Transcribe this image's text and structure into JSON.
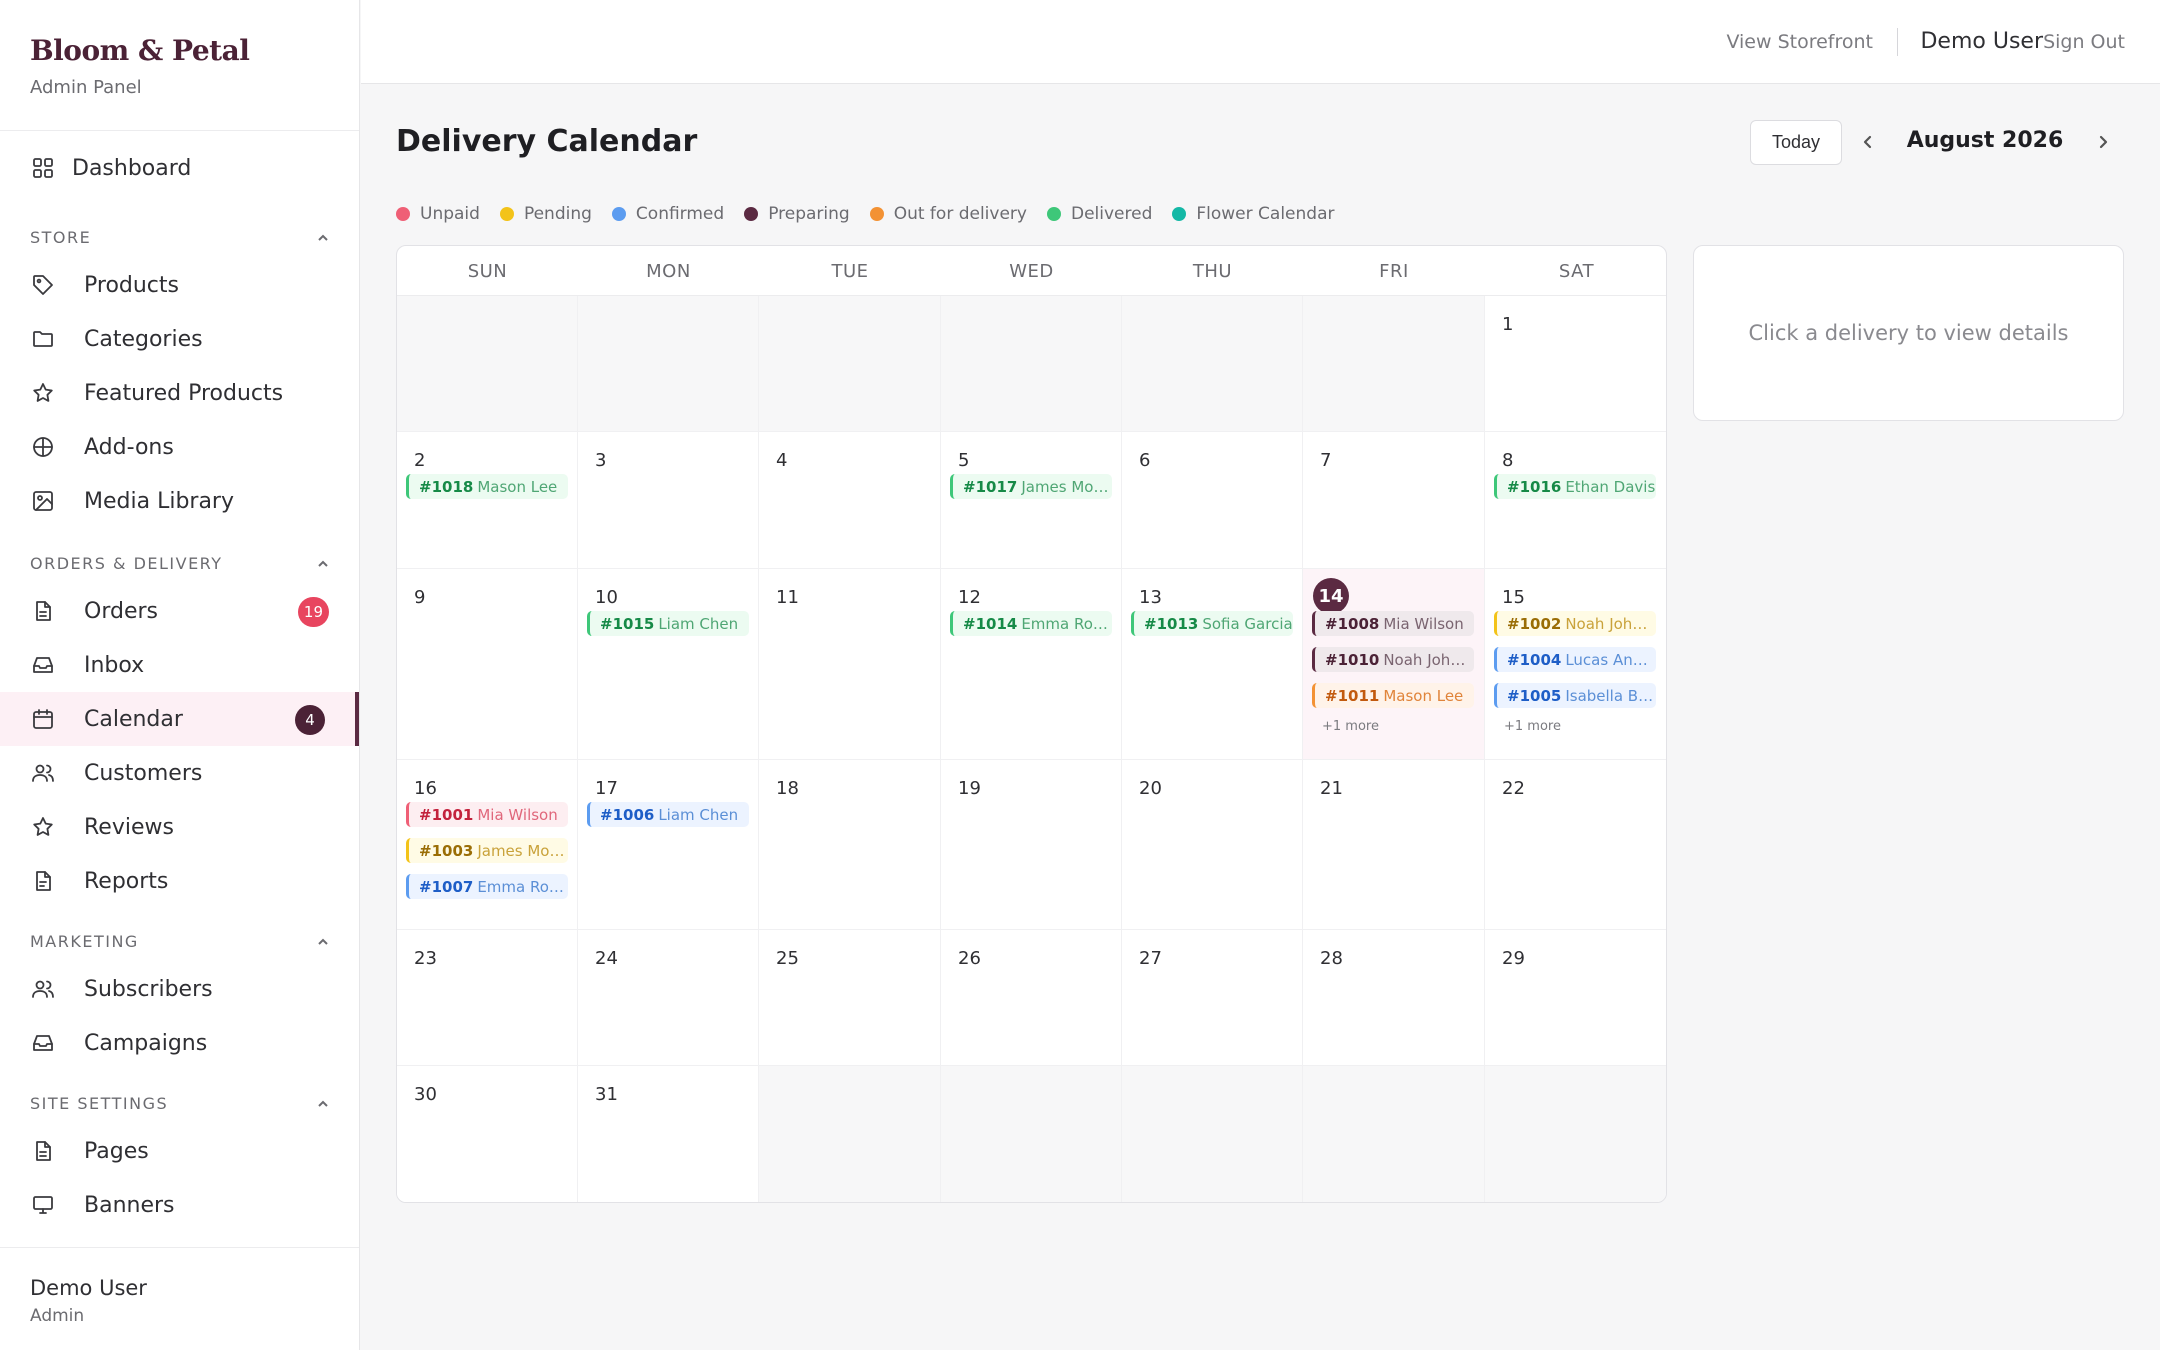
{
  "brand": {
    "name": "Bloom & Petal",
    "subtitle": "Admin Panel"
  },
  "sidebar": {
    "dashboard": "Dashboard",
    "sections": [
      {
        "title": "STORE",
        "items": [
          "Products",
          "Categories",
          "Featured Products",
          "Add-ons",
          "Media Library"
        ]
      },
      {
        "title": "ORDERS & DELIVERY",
        "items": [
          "Orders",
          "Inbox",
          "Calendar",
          "Customers",
          "Reviews",
          "Reports"
        ]
      },
      {
        "title": "MARKETING",
        "items": [
          "Subscribers",
          "Campaigns"
        ]
      },
      {
        "title": "SITE SETTINGS",
        "items": [
          "Pages",
          "Banners"
        ]
      }
    ],
    "badges": {
      "orders": "19",
      "calendar": "4"
    },
    "active_item": "Calendar",
    "footer": {
      "name": "Demo User",
      "role": "Admin"
    }
  },
  "topbar": {
    "storefront": "View Storefront",
    "user": "Demo User",
    "signout": "Sign Out"
  },
  "main": {
    "title": "Delivery Calendar",
    "today_button": "Today",
    "month": "August 2026",
    "details_placeholder": "Click a delivery to view details"
  },
  "legend": [
    {
      "label": "Unpaid",
      "color": "#ef5f76"
    },
    {
      "label": "Pending",
      "color": "#f3c319"
    },
    {
      "label": "Confirmed",
      "color": "#5c9cf0"
    },
    {
      "label": "Preparing",
      "color": "#5b2a42"
    },
    {
      "label": "Out for delivery",
      "color": "#f39234"
    },
    {
      "label": "Delivered",
      "color": "#3ec779"
    },
    {
      "label": "Flower Calendar",
      "color": "#14b8a6"
    }
  ],
  "calendar": {
    "weekdays": [
      "SUN",
      "MON",
      "TUE",
      "WED",
      "THU",
      "FRI",
      "SAT"
    ],
    "today": "14",
    "weeks": [
      [
        null,
        null,
        null,
        null,
        null,
        null,
        {
          "day": "1"
        }
      ],
      [
        {
          "day": "2",
          "events": [
            {
              "id": "#1018",
              "customer": "Mason Lee",
              "status": "delivered"
            }
          ]
        },
        {
          "day": "3"
        },
        {
          "day": "4"
        },
        {
          "day": "5",
          "events": [
            {
              "id": "#1017",
              "customer": "James Moore",
              "status": "delivered"
            }
          ]
        },
        {
          "day": "6"
        },
        {
          "day": "7"
        },
        {
          "day": "8",
          "events": [
            {
              "id": "#1016",
              "customer": "Ethan Davis",
              "status": "delivered"
            }
          ]
        }
      ],
      [
        {
          "day": "9"
        },
        {
          "day": "10",
          "events": [
            {
              "id": "#1015",
              "customer": "Liam Chen",
              "status": "delivered"
            }
          ]
        },
        {
          "day": "11"
        },
        {
          "day": "12",
          "events": [
            {
              "id": "#1014",
              "customer": "Emma Rodriguez",
              "status": "delivered"
            }
          ]
        },
        {
          "day": "13",
          "events": [
            {
              "id": "#1013",
              "customer": "Sofia Garcia",
              "status": "delivered"
            }
          ]
        },
        {
          "day": "14",
          "events": [
            {
              "id": "#1008",
              "customer": "Mia Wilson",
              "status": "preparing"
            },
            {
              "id": "#1010",
              "customer": "Noah Johnson",
              "status": "preparing"
            },
            {
              "id": "#1011",
              "customer": "Mason Lee",
              "status": "outfor"
            }
          ],
          "more": "+1 more"
        },
        {
          "day": "15",
          "events": [
            {
              "id": "#1002",
              "customer": "Noah Johnson",
              "status": "pending"
            },
            {
              "id": "#1004",
              "customer": "Lucas Anderson",
              "status": "confirmed"
            },
            {
              "id": "#1005",
              "customer": "Isabella Brown",
              "status": "confirmed"
            }
          ],
          "more": "+1 more"
        }
      ],
      [
        {
          "day": "16",
          "events": [
            {
              "id": "#1001",
              "customer": "Mia Wilson",
              "status": "unpaid"
            },
            {
              "id": "#1003",
              "customer": "James Moore",
              "status": "pending"
            },
            {
              "id": "#1007",
              "customer": "Emma Rodriguez",
              "status": "confirmed"
            }
          ]
        },
        {
          "day": "17",
          "events": [
            {
              "id": "#1006",
              "customer": "Liam Chen",
              "status": "confirmed"
            }
          ]
        },
        {
          "day": "18"
        },
        {
          "day": "19"
        },
        {
          "day": "20"
        },
        {
          "day": "21"
        },
        {
          "day": "22"
        }
      ],
      [
        {
          "day": "23"
        },
        {
          "day": "24"
        },
        {
          "day": "25"
        },
        {
          "day": "26"
        },
        {
          "day": "27"
        },
        {
          "day": "28"
        },
        {
          "day": "29"
        }
      ],
      [
        {
          "day": "30"
        },
        {
          "day": "31"
        },
        null,
        null,
        null,
        null,
        null
      ]
    ]
  }
}
